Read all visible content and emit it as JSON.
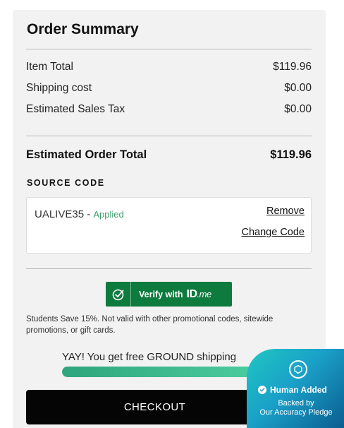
{
  "summary": {
    "title": "Order Summary",
    "lines": [
      {
        "label": "Item Total",
        "value": "$119.96"
      },
      {
        "label": "Shipping cost",
        "value": "$0.00"
      },
      {
        "label": "Estimated Sales Tax",
        "value": "$0.00"
      }
    ],
    "total_label": "Estimated Order Total",
    "total_value": "$119.96"
  },
  "source_code": {
    "heading": "SOURCE CODE",
    "code": "UALIVE35",
    "separator": " - ",
    "status": "Applied",
    "remove_label": "Remove",
    "change_label": "Change Code"
  },
  "verify": {
    "label": "Verify with",
    "brand": "ID",
    "brand_suffix": ".me",
    "icon": "check-circle-icon"
  },
  "note": "Students Save 15%. Not valid with other promotional codes, sitewide promotions, or gift cards.",
  "shipping": {
    "message": "YAY! You get free GROUND shipping",
    "progress_percent": 100
  },
  "checkout": {
    "label": "CHECKOUT"
  },
  "badge": {
    "title": "Human Added",
    "line1": "Backed by",
    "line2": "Our Accuracy Pledge",
    "icon": "shield-icon"
  },
  "colors": {
    "verify_green": "#0d7a3e",
    "applied_green": "#3e9b6c",
    "progress_green": "#2ea57c",
    "checkout_black": "#050505",
    "badge_teal": "#1fc7c2"
  }
}
